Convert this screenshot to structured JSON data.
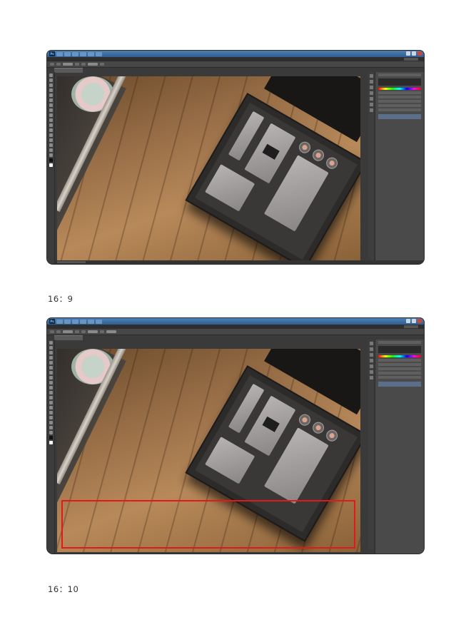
{
  "screenshots": [
    {
      "aspect_ratio_caption": "16：9",
      "highlight": false
    },
    {
      "aspect_ratio_caption": "16：10",
      "highlight": true,
      "highlight_color": "#e01a1a"
    }
  ],
  "colors": {
    "titlebar": "#3b6ea3",
    "menubar": "#2e2e2e",
    "workspace": "#3a3a3a",
    "highlight": "#e01a1a"
  },
  "icons": [
    "photoshop-app-icon",
    "tool-icons",
    "foreground-color-icon",
    "background-color-icon"
  ]
}
